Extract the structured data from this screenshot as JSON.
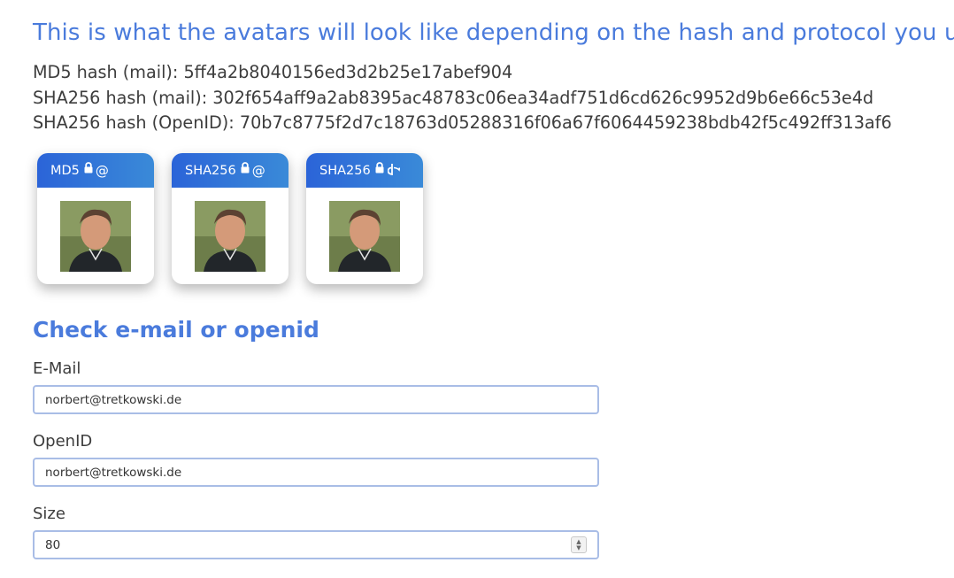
{
  "header": {
    "title": "This is what the avatars will look like depending on the hash and protocol you use:"
  },
  "hashes": [
    {
      "label": "MD5 hash (mail):",
      "value": "5ff4a2b8040156ed3d2b25e17abef904"
    },
    {
      "label": "SHA256 hash (mail):",
      "value": "302f654aff9a2ab8395ac48783c06ea34adf751d6cd626c9952d9b6e66c53e4d"
    },
    {
      "label": "SHA256 hash (OpenID):",
      "value": "70b7c8775f2d7c18763d05288316f06a67f6064459238bdb42f5c492ff313af6"
    }
  ],
  "cards": [
    {
      "label": "MD5",
      "icons": [
        "lock-icon",
        "at-icon"
      ]
    },
    {
      "label": "SHA256",
      "icons": [
        "lock-icon",
        "at-icon"
      ]
    },
    {
      "label": "SHA256",
      "icons": [
        "lock-icon",
        "openid-icon"
      ]
    }
  ],
  "check": {
    "title": "Check e-mail or openid",
    "email_label": "E-Mail",
    "email_value": "norbert@tretkowski.de",
    "openid_label": "OpenID",
    "openid_value": "norbert@tretkowski.de",
    "size_label": "Size",
    "size_value": "80"
  },
  "colors": {
    "accent": "#4a7bdc",
    "card_header_start": "#2b64d8",
    "card_header_end": "#3a8ad8",
    "input_border": "#a9bde6"
  }
}
